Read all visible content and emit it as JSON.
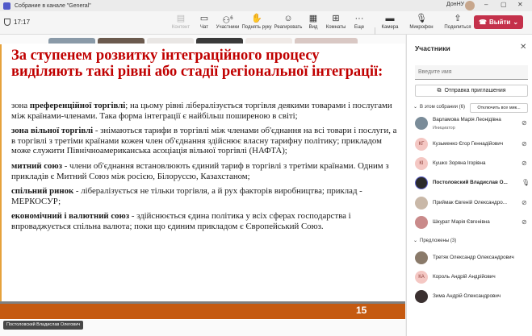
{
  "window": {
    "title": "Собрание в канале \"General\"",
    "user_name": "ДонНУ"
  },
  "toolbar": {
    "timer": "17:17",
    "buttons": [
      {
        "label": "Контент",
        "icon": "share-icon",
        "enabled": false
      },
      {
        "label": "Чат",
        "icon": "chat-icon",
        "enabled": true
      },
      {
        "label": "Участники",
        "icon": "participants-icon",
        "badge": "6",
        "enabled": true
      },
      {
        "label": "Поднять руку",
        "icon": "raise-hand-icon",
        "enabled": true
      },
      {
        "label": "Реагировать",
        "icon": "reactions-icon",
        "enabled": true
      },
      {
        "label": "Вид",
        "icon": "view-icon",
        "enabled": true
      },
      {
        "label": "Комнаты",
        "icon": "rooms-icon",
        "enabled": true
      },
      {
        "label": "Еще",
        "icon": "more-icon",
        "enabled": true
      },
      {
        "label": "Камера",
        "icon": "camera-icon",
        "enabled": true
      },
      {
        "label": "Микрофон",
        "icon": "microphone-icon",
        "enabled": true
      },
      {
        "label": "Поделиться",
        "icon": "share-screen-icon",
        "enabled": true
      }
    ],
    "leave_label": "Выйти"
  },
  "video_strip": [
    {
      "type": "video",
      "color": "#8a9aa8"
    },
    {
      "type": "video",
      "color": "#6b5a4e"
    },
    {
      "type": "video",
      "color": "#e9e6e4"
    },
    {
      "type": "video",
      "color": "#3a3a3a"
    },
    {
      "type": "initials",
      "initials": "КГ"
    },
    {
      "type": "video",
      "color": "#d9c8c4"
    }
  ],
  "slide": {
    "title": "За ступенем розвитку інтеграційного процесу виділяють такі рівні або  стадії регіональної інтеграції:",
    "items": [
      {
        "term": "преференційної торгівлі",
        "prefix": "зона ",
        "text": "; на цьому рівні лібералізується  торгівля деякими товарами і послугами між країнами-членами. Така форма інтеграції є найбільш поширеною в світі;"
      },
      {
        "term": "зона вільної торгівлі",
        "prefix": "",
        "text": " - знімаються тарифи в торгівлі між членами об'єднання на всі товари і послуги, а в торгівлі з третіми країнами кожен член об'єднання здійснює власну тарифну політику; прикладом може служити Північноамериканська асоціація вільної торгівлі (НАФТА);"
      },
      {
        "term": "митний союз",
        "prefix": "",
        "text": " - члени об'єднання встановлюють єдиний тариф в торгівлі з третіми країнами. Одним з прикладів є Митний Союз між росією, Білоруссю, Казахстаном;"
      },
      {
        "term": "спільний ринок",
        "prefix": "",
        "text": " - лібералізується не тільки торгівля, а й рух факторів виробництва; приклад - МЕРКОСУР;"
      },
      {
        "term": "економічний і валютний союз",
        "prefix": "",
        "text": " - здійснюється єдина політика у всіх сферах господарства і впроваджується спільна валюта; поки що єдиним прикладом є Європейський Союз."
      }
    ],
    "page_number": "15"
  },
  "presenter_label": "Постоловский Владислав Олегович",
  "participants_pane": {
    "title": "Участники",
    "search_placeholder": "Введите имя",
    "invite_label": "Отправка приглашения",
    "in_call_label": "В этом собрании (6)",
    "mute_all_label": "Отключить все мик...",
    "in_call": [
      {
        "name": "Варламова Марія Леонідівна",
        "sub": "Инициатор",
        "initials": "",
        "avatar_color": "#7a8c99"
      },
      {
        "name": "Кузьменко Єгор Геннадійович",
        "sub": "",
        "initials": "КГ",
        "avatar_color": "#f4c7c3"
      },
      {
        "name": "Кушко Зоряна Ігорівна",
        "sub": "",
        "initials": "КІ",
        "avatar_color": "#f4c7c3"
      },
      {
        "name": "Постоловский Владислав О...",
        "sub": "",
        "initials": "",
        "avatar_color": "#2b2b2b"
      },
      {
        "name": "Приймак Євгеній Олександро...",
        "sub": "",
        "initials": "",
        "avatar_color": "#c9b8a8"
      },
      {
        "name": "Шкурат Марія Євгенівна",
        "sub": "",
        "initials": "",
        "avatar_color": "#c98a8a"
      }
    ],
    "suggested_label": "Предложены (3)",
    "suggested": [
      {
        "name": "Третяк Олександр Олександрович",
        "initials": "",
        "avatar_color": "#8a7a6a"
      },
      {
        "name": "Король Андрій Андрійович",
        "initials": "КА",
        "avatar_color": "#f4c7c3"
      },
      {
        "name": "Зима Андрій Олександрович",
        "initials": "",
        "avatar_color": "#3a3030"
      }
    ]
  }
}
